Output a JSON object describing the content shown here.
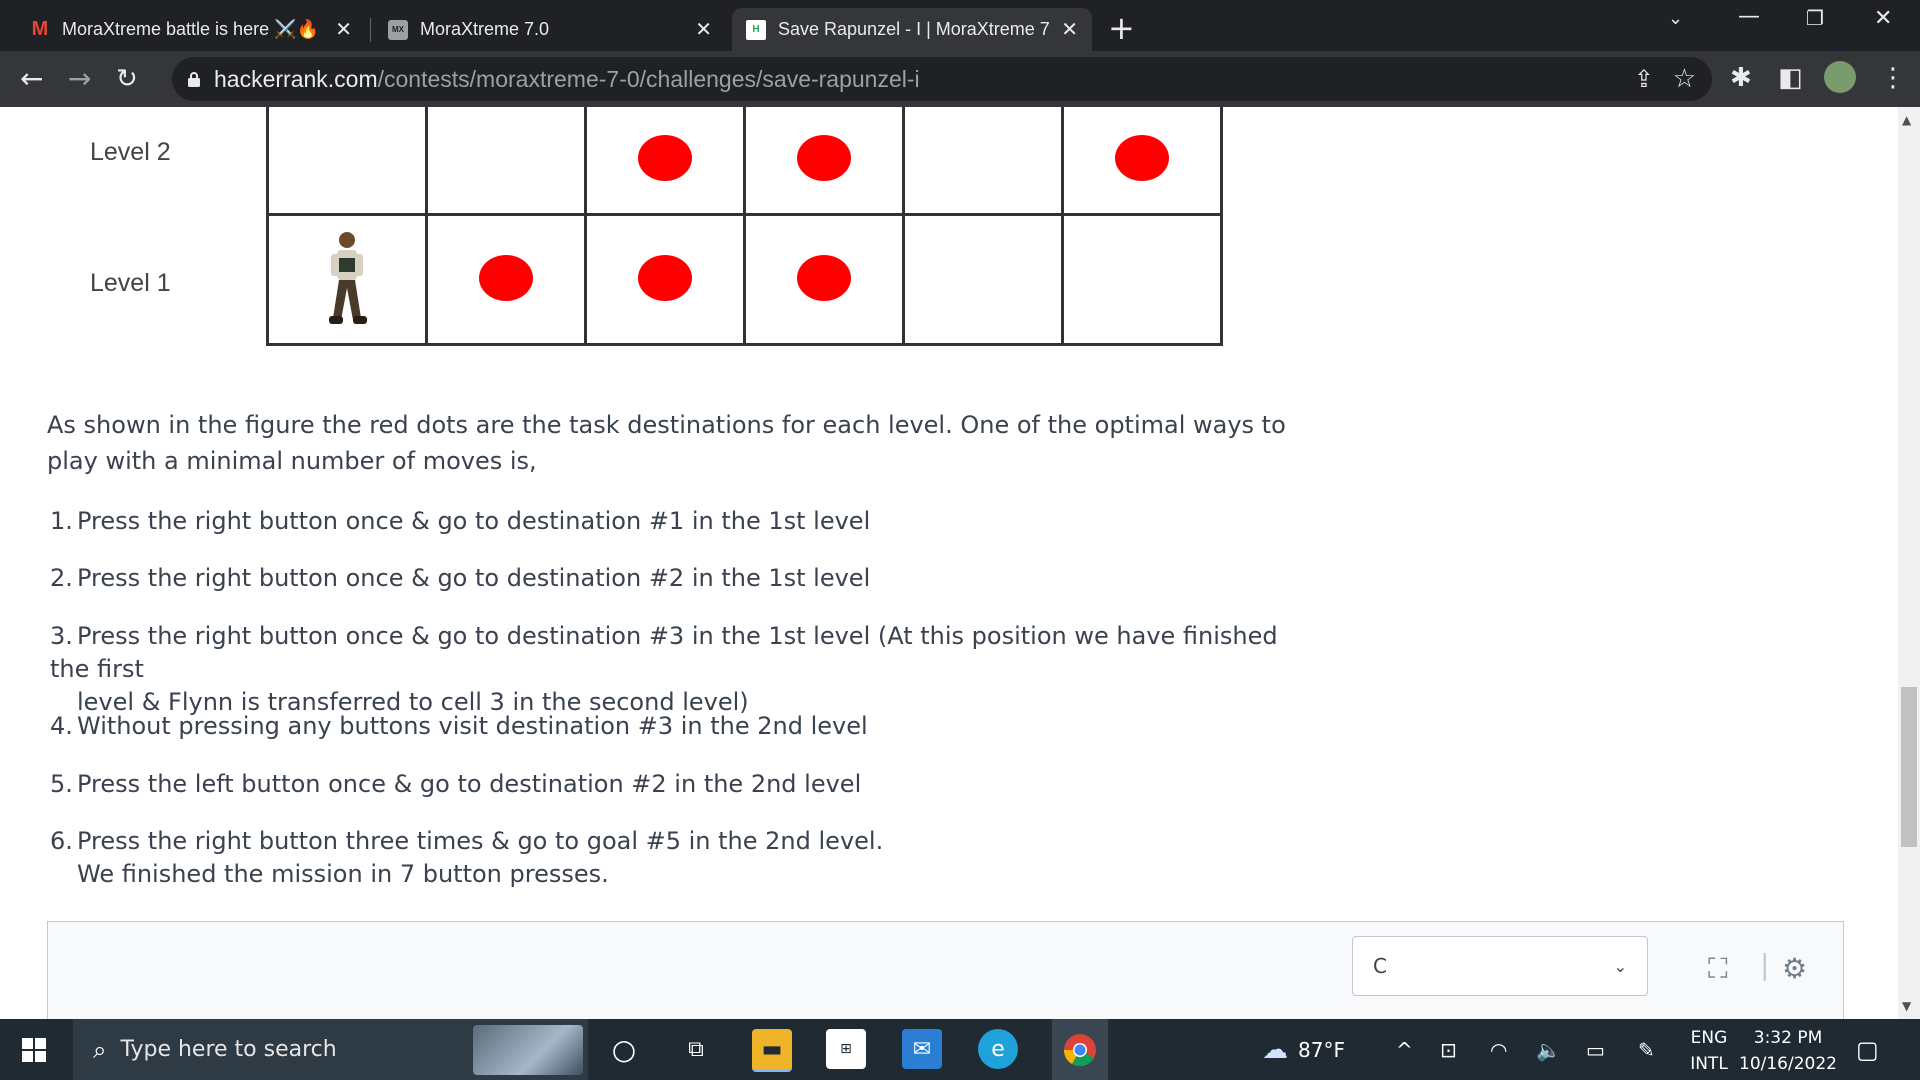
{
  "tabs": [
    {
      "title": "MoraXtreme battle is here ⚔️🔥",
      "favicon": "gmail-icon",
      "active": false
    },
    {
      "title": "MoraXtreme 7.0",
      "favicon": "moraxtreme-icon",
      "active": false
    },
    {
      "title": "Save Rapunzel - I | MoraXtreme 7",
      "favicon": "hackerrank-icon",
      "active": true
    }
  ],
  "address_bar": {
    "host": "hackerrank.com",
    "path": "/contests/moraxtreme-7-0/challenges/save-rapunzel-i"
  },
  "figure": {
    "row_labels": [
      "Level 2",
      "Level 1"
    ],
    "level2_dots": [
      false,
      false,
      true,
      true,
      false,
      true
    ],
    "level1_dots": [
      false,
      true,
      true,
      true,
      false,
      false
    ],
    "character_cell": "level1-cell1"
  },
  "problem": {
    "description": "As shown in the figure the red dots are the task destinations for each level. One of the optimal ways to play with a minimal number of moves is,",
    "steps": [
      {
        "num": "1.",
        "text": "Press the right button once & go to destination #1 in the 1st level",
        "cont": ""
      },
      {
        "num": "2.",
        "text": "Press the right button once & go to destination #2 in the 1st level",
        "cont": ""
      },
      {
        "num": "3.",
        "text": "Press the right button once & go to destination #3 in the 1st level (At this position we have finished the first",
        "cont": "level & Flynn is transferred to cell 3 in the second level)"
      },
      {
        "num": "4.",
        "text": "Without pressing any buttons visit destination #3 in the 2nd level",
        "cont": ""
      },
      {
        "num": "5.",
        "text": "Press the left button once & go to destination #2 in the 2nd level",
        "cont": ""
      },
      {
        "num": "6.",
        "text": "Press the right button three times & go to goal #5 in the 2nd level.",
        "cont": "We finished the mission in 7 button presses."
      }
    ]
  },
  "editor": {
    "language": "C"
  },
  "taskbar": {
    "search_placeholder": "Type here to search",
    "weather": "87°F",
    "lang_top": "ENG",
    "lang_bottom": "INTL",
    "time": "3:32 PM",
    "date": "10/16/2022"
  },
  "colors": {
    "dot": "#ff0000",
    "chrome_dark": "#202124",
    "chrome_toolbar": "#35363a",
    "text": "#39424e"
  }
}
